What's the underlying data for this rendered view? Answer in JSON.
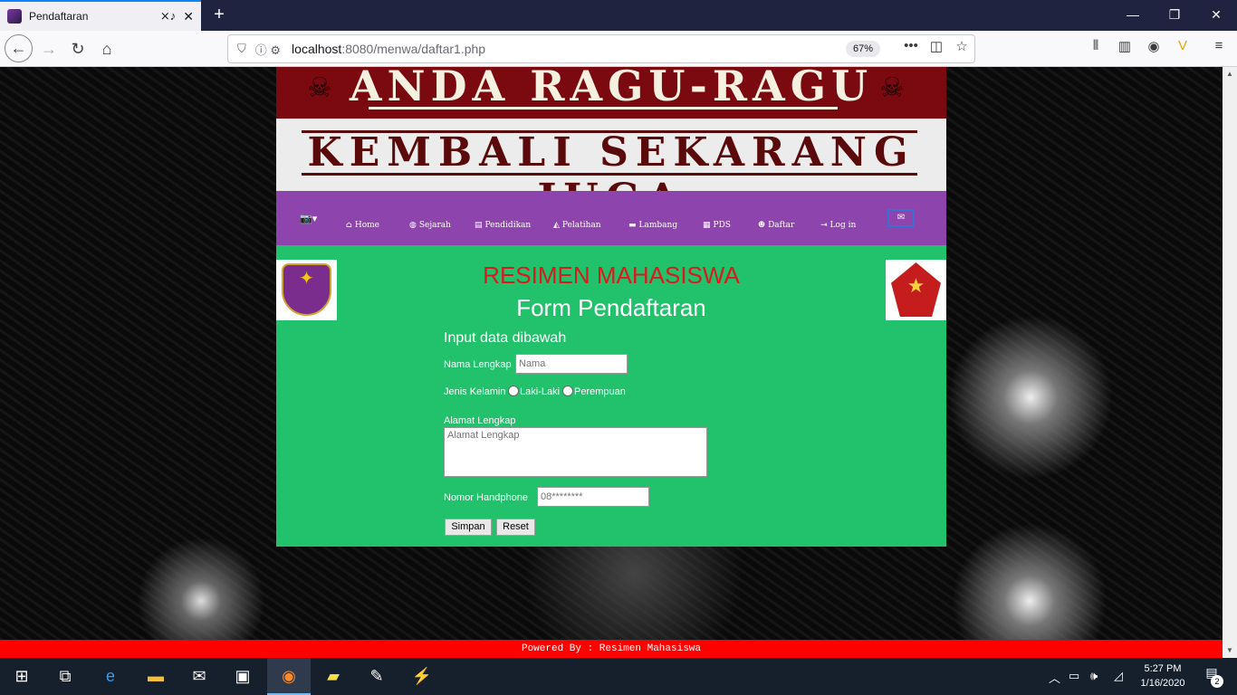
{
  "browser": {
    "tab_title": "Pendaftaran",
    "url_host": "localhost",
    "url_path": ":8080/menwa/daftar1.php",
    "zoom": "67%"
  },
  "site": {
    "banner_top": "ANDA RAGU-RAGU",
    "banner_bottom": "KEMBALI SEKARANG JUGA",
    "menu": [
      {
        "label": "Home",
        "icon": "home-icon"
      },
      {
        "label": "Sejarah",
        "icon": "globe-icon"
      },
      {
        "label": "Pendidikan",
        "icon": "book-icon"
      },
      {
        "label": "Pelatihan",
        "icon": "graduation-cap-icon"
      },
      {
        "label": "Lambang",
        "icon": "flag-icon"
      },
      {
        "label": "PDS",
        "icon": "map-icon"
      },
      {
        "label": "Daftar",
        "icon": "users-icon"
      },
      {
        "label": "Log in",
        "icon": "sign-in-icon"
      }
    ],
    "heading": "RESIMEN MAHASISWA",
    "subheading": "Form Pendaftaran",
    "form": {
      "intro": "Input data dibawah",
      "name_label": "Nama Lengkap",
      "name_placeholder": "Nama",
      "gender_label": "Jenis Kelamin",
      "gender_male": "Laki-Laki",
      "gender_female": "Perempuan",
      "address_label": "Alamat Lengkap",
      "address_placeholder": "Alamat Lengkap",
      "phone_label": "Nomor Handphone",
      "phone_placeholder": "08********",
      "submit": "Simpan",
      "reset": "Reset"
    },
    "footer": "Powered By : Resimen Mahasiswa"
  },
  "taskbar": {
    "time": "5:27 PM",
    "date": "1/16/2020",
    "notifications": "2"
  }
}
